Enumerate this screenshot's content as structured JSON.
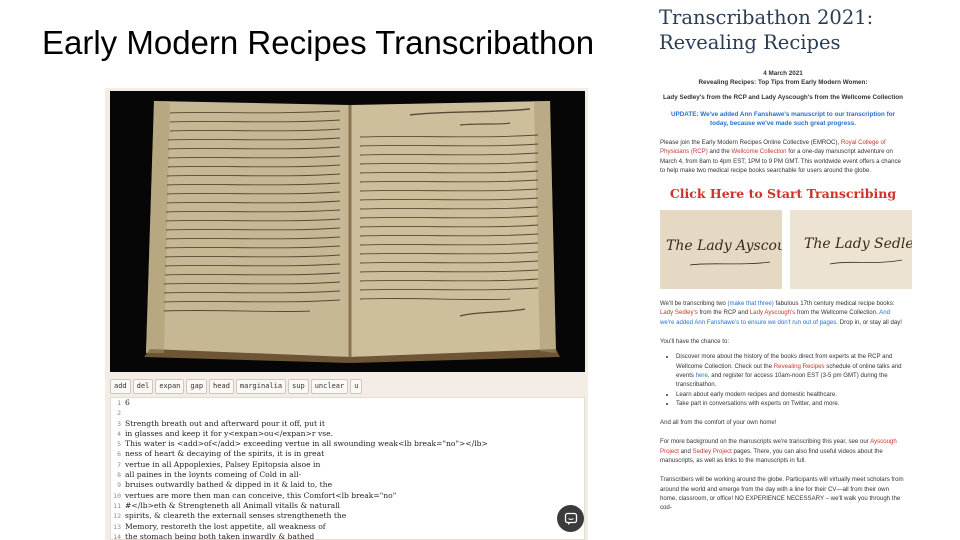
{
  "slide": {
    "title": "Early Modern Recipes Transcribathon"
  },
  "toolbar": {
    "buttons": [
      "add",
      "del",
      "expan",
      "gap",
      "head",
      "marginalia",
      "sup",
      "unclear",
      "u"
    ]
  },
  "editor": {
    "lines": [
      {
        "n": "1",
        "text": "6"
      },
      {
        "n": "2",
        "text": ""
      },
      {
        "n": "3",
        "text": "Strength breath out and afterward pour it off, put it"
      },
      {
        "n": "4",
        "text": "in glasses and keep it for y<expan>ou</expan>r vse."
      },
      {
        "n": "5",
        "text": "This water is <add>of</add> exceeding vertue in all swounding weak<lb break=\"no\"></lb>"
      },
      {
        "n": "6",
        "text": "ness of heart & decaying of the spirits, it is in great"
      },
      {
        "n": "7",
        "text": "vertue in all Appoplexies, Palsey Epitopsia alsoe in"
      },
      {
        "n": "8",
        "text": "all paines in the loynts comeing of Cold in all-"
      },
      {
        "n": "9",
        "text": "bruises outwardly bathed & dipped in it & laid to, the"
      },
      {
        "n": "10",
        "text": "vertues are more then man can conceive, this Comfort<lb break=\"no\""
      },
      {
        "n": "11",
        "text": "#</lb>eth & Strengteneth all Animall vitalls & naturall"
      },
      {
        "n": "12",
        "text": "spirits, & cleareth the externall senses strengtheneth the"
      },
      {
        "n": "13",
        "text": "Memory, restoreth the lost appetite, all weakness of"
      },
      {
        "n": "14",
        "text": "the stomach being both taken inwardly & bathed"
      }
    ]
  },
  "chat": {
    "icon": "chat-bubble-icon"
  },
  "web": {
    "title_line1": "Transcribathon 2021:",
    "title_line2": "Revealing Recipes",
    "date": "4 March 2021",
    "subtitle": "Revealing Recipes: Top Tips from Early Modern Women:",
    "subtitle2": "Lady Sedley's from the RCP and Lady Ayscough's from the Wellcome Collection",
    "update": "UPDATE: We've added Ann Fanshawe's manuscript to our transcription for today, because we've made such great progress.",
    "para1": {
      "t1": "Please join the Early Modern Recipes Online Collective (EMROC), ",
      "l1": "Royal College of Physicians (RCP)",
      "t2": " and the ",
      "l2": "Wellcome Collection",
      "t3": " for a one-day manuscript adventure on March 4, from 8am to 4pm EST; 1PM to 9 PM GMT. This worldwide event offers a chance to help make two medical recipe books searchable for users around the globe."
    },
    "cta": "Click Here to Start Transcribing",
    "thumb1_caption": "The Lady Ayscough",
    "thumb2_caption": "The Lady Sedley",
    "para2": {
      "t1": "We'll be transcribing two ",
      "b1": "(make that three)",
      "t2": " fabulous 17th century medical recipe books: ",
      "l1": "Lady Sedley's",
      "t3": " from the RCP and ",
      "l2": "Lady Ayscough's",
      "t4": " from the Wellcome Collection. ",
      "b2": "And we're added Ann Fanshawe's to ensure we don't run out of pages.",
      "t5": " Drop in, or stay all day!"
    },
    "para3": "You'll have the chance to:",
    "list": [
      {
        "t1": "Discover more about the history of the books direct from experts at the RCP and Wellcome Collection. Check out the ",
        "l1": "Revealing Recipes",
        "t2": " schedule of online talks and events ",
        "l2": "here",
        "t3": ", and register for access 10am-noon EST (3-5 pm GMT) during the transcribathon."
      },
      {
        "t1": "Learn about early modern recipes and domestic healthcare.",
        "l1": "",
        "t2": "",
        "l2": "",
        "t3": ""
      },
      {
        "t1": "Take part in conversations with experts on Twitter, and more.",
        "l1": "",
        "t2": "",
        "l2": "",
        "t3": ""
      }
    ],
    "para4": "And all from the comfort of your own home!",
    "para5": {
      "t1": "For more background on the manuscripts we're transcribing this year, see our ",
      "l1": "Ayscough Project",
      "t2": " and ",
      "l2": "Sedley Project",
      "t3": " pages. There, you can also find useful videos about the manuscripts, as well as links to the manuscripts in full."
    },
    "para6": "Transcribers will be working around the globe.  Participants will virtually meet scholars from around the world and emerge from the day with a line for their CV—all from their own home, classroom, or office! NO EXPERIENCE NECESSARY – we'll walk you through the cod-"
  }
}
